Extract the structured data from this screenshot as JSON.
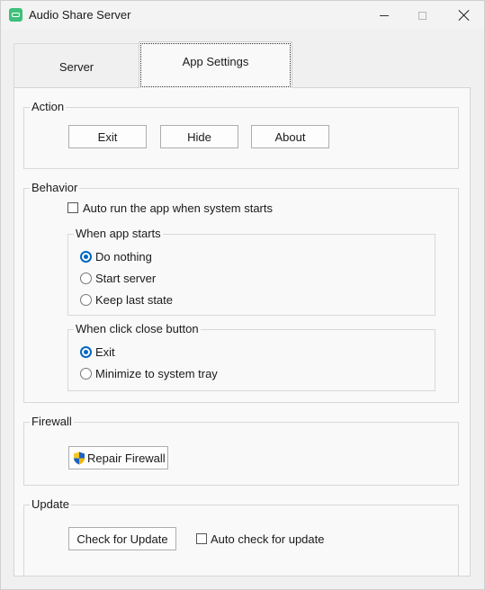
{
  "window": {
    "title": "Audio Share Server",
    "app_icon": "audio-share-icon",
    "controls": [
      "minimize-icon",
      "maximize-icon",
      "close-icon"
    ]
  },
  "tabs": [
    {
      "label": "Server",
      "selected": false
    },
    {
      "label": "App Settings",
      "selected": true
    }
  ],
  "action": {
    "title": "Action",
    "exit_label": "Exit",
    "hide_label": "Hide",
    "about_label": "About"
  },
  "behavior": {
    "title": "Behavior",
    "autorun_label": "Auto run the app when system starts",
    "autorun_checked": false,
    "when_app_starts": {
      "title": "When app starts",
      "options": [
        {
          "label": "Do nothing",
          "selected": true
        },
        {
          "label": "Start server",
          "selected": false
        },
        {
          "label": "Keep last state",
          "selected": false
        }
      ]
    },
    "when_close": {
      "title": "When click close button",
      "options": [
        {
          "label": "Exit",
          "selected": true
        },
        {
          "label": "Minimize to system tray",
          "selected": false
        }
      ]
    }
  },
  "firewall": {
    "title": "Firewall",
    "repair_label": "Repair Firewall",
    "repair_icon": "uac-shield-icon"
  },
  "update": {
    "title": "Update",
    "check_label": "Check for Update",
    "auto_check_label": "Auto check for update",
    "auto_check_checked": false
  },
  "colors": {
    "accent": "#0067c0",
    "window_bg": "#f0f0f0",
    "panel_bg": "#f9f9f9",
    "app_icon": "#3ec07a"
  }
}
